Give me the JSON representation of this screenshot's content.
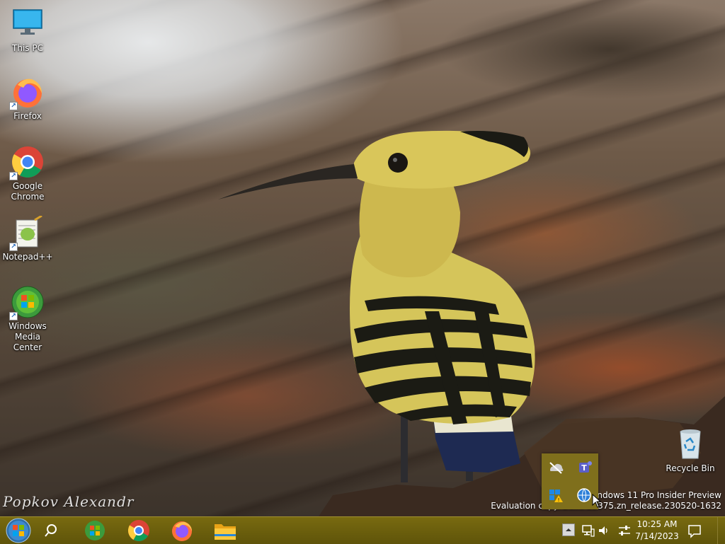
{
  "desktop": {
    "icons": [
      {
        "label": "This PC",
        "icon": "this-pc-icon"
      },
      {
        "label": "Firefox",
        "icon": "firefox-icon"
      },
      {
        "label": "Google Chrome",
        "icon": "chrome-icon"
      },
      {
        "label": "Notepad++",
        "icon": "notepadpp-icon"
      },
      {
        "label": "Windows Media Center",
        "icon": "media-center-icon"
      }
    ],
    "recycle_bin": {
      "label": "Recycle Bin",
      "icon": "recycle-bin-icon"
    },
    "watermark_signature": "Popkov Alexandr",
    "os_watermark": {
      "line1": "Windows 11 Pro Insider Preview",
      "line2": "Evaluation copy. Build 25375.zn_release.230520-1632"
    }
  },
  "tray_overflow": {
    "items": [
      {
        "icon": "onedrive-offline-icon"
      },
      {
        "icon": "teams-icon"
      },
      {
        "icon": "security-warning-icon"
      },
      {
        "icon": "network-globe-icon"
      }
    ]
  },
  "taskbar": {
    "start": {
      "icon": "windows-start-icon"
    },
    "search": {
      "icon": "search-icon"
    },
    "pinned": [
      {
        "icon": "media-center-icon",
        "name": "Windows Media Center"
      },
      {
        "icon": "chrome-icon",
        "name": "Google Chrome"
      },
      {
        "icon": "firefox-icon",
        "name": "Firefox"
      },
      {
        "icon": "file-explorer-icon",
        "name": "File Explorer"
      }
    ],
    "tray": {
      "icons": [
        "chevron-up-icon",
        "network-icon",
        "volume-icon",
        "settings-sliders-icon"
      ],
      "time": "10:25 AM",
      "date": "7/14/2023",
      "notification_icon": "notification-icon"
    }
  },
  "colors": {
    "taskbar": "#786a10",
    "tray_popup": "#7f6f1c"
  }
}
